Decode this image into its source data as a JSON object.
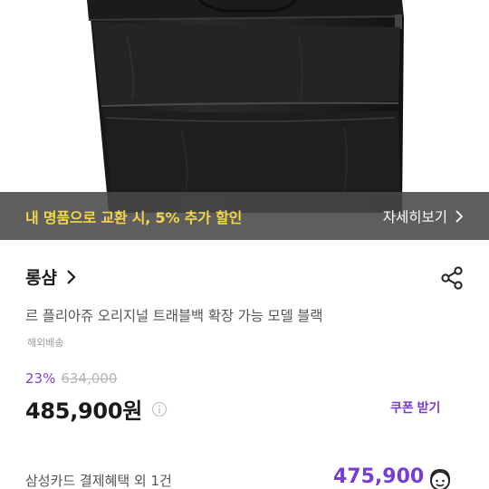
{
  "promo": {
    "text": "내 명품으로 교환 시, 5% 추가 할인",
    "link_label": "자세히보기",
    "text_color": "#f2d64b"
  },
  "product": {
    "brand": "롱샴",
    "title": "르 플리아쥬 오리지널 트래블백 확장 가능 모델 블랙",
    "shipping": "해외배송",
    "discount_rate": "23%",
    "original_price": "634,000",
    "price": "485,900원",
    "coupon_label": "쿠폰 받기"
  },
  "card_offer": {
    "benefit": "삼성카드 결제혜택 외 1건",
    "price": "475,900"
  },
  "colors": {
    "accent": "#7a3cd6",
    "bag": "#1c1c1e"
  },
  "icons": {
    "share": "share-icon",
    "info": "info-icon",
    "chevron": "chevron-right-icon",
    "support": "support-agent-icon"
  }
}
